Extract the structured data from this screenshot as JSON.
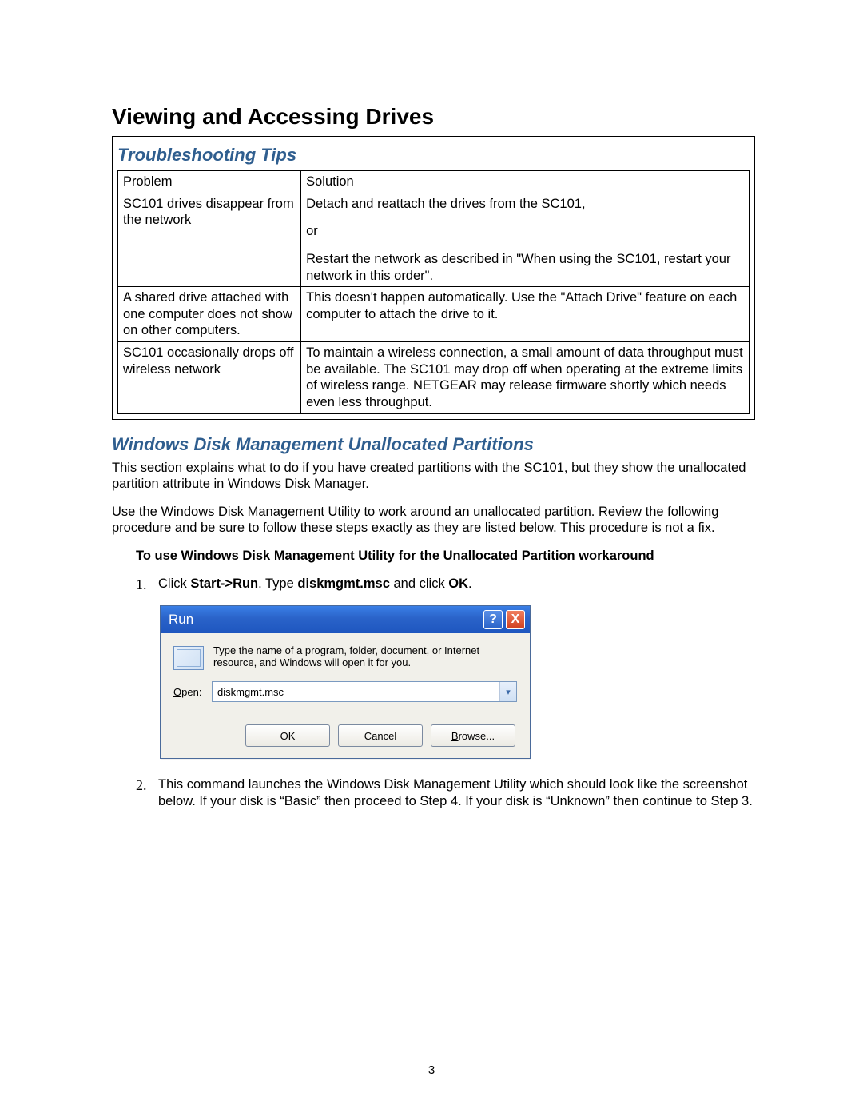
{
  "heading": "Viewing and Accessing Drives",
  "section1": {
    "title": "Troubleshooting Tips",
    "header": {
      "problem": "Problem",
      "solution": "Solution"
    },
    "rows": [
      {
        "problem": "SC101 drives disappear from the network",
        "solution_a": "Detach and reattach the drives from the SC101,",
        "solution_b": "or",
        "solution_c": "Restart the network as described in \"When using the SC101, restart your network in this order\"."
      },
      {
        "problem": "A shared drive attached with one computer does not show on other computers.",
        "solution": "This doesn't happen automatically. Use the \"Attach Drive\" feature on each computer to attach the drive to it."
      },
      {
        "problem": "SC101 occasionally drops off wireless network",
        "solution": "To maintain a wireless connection, a small amount of data throughput must be available. The SC101 may drop off when operating at the extreme limits of wireless range. NETGEAR may release firmware shortly which needs even less throughput."
      }
    ]
  },
  "section2": {
    "title": "Windows Disk Management Unallocated Partitions",
    "para1": "This section explains what to do if you have created partitions with the SC101, but they show the unallocated partition attribute in Windows Disk Manager.",
    "para2": "Use the Windows Disk Management Utility to work around an unallocated partition. Review the following procedure and be sure to follow these steps exactly as they are listed below. This procedure is not a fix.",
    "bold_intro": "To use Windows Disk Management Utility for the Unallocated Partition workaround",
    "step1": {
      "num": "1.",
      "pre": "Click ",
      "b1": "Start->Run",
      "mid": ". Type ",
      "b2": "diskmgmt.msc",
      "mid2": " and click ",
      "b3": "OK",
      "end": "."
    },
    "step2": {
      "num": "2.",
      "text": "This command launches the Windows Disk Management Utility which should look like the screenshot below. If your disk is “Basic” then proceed to Step 4. If your disk is “Unknown” then continue to Step 3."
    }
  },
  "run_dialog": {
    "title": "Run",
    "help": "?",
    "close": "X",
    "desc": "Type the name of a program, folder, document, or Internet resource, and Windows will open it for you.",
    "open_label_u": "O",
    "open_label_rest": "pen:",
    "value": "diskmgmt.msc",
    "btn_ok": "OK",
    "btn_cancel": "Cancel",
    "btn_browse_u": "B",
    "btn_browse_rest": "rowse..."
  },
  "page_number": "3"
}
